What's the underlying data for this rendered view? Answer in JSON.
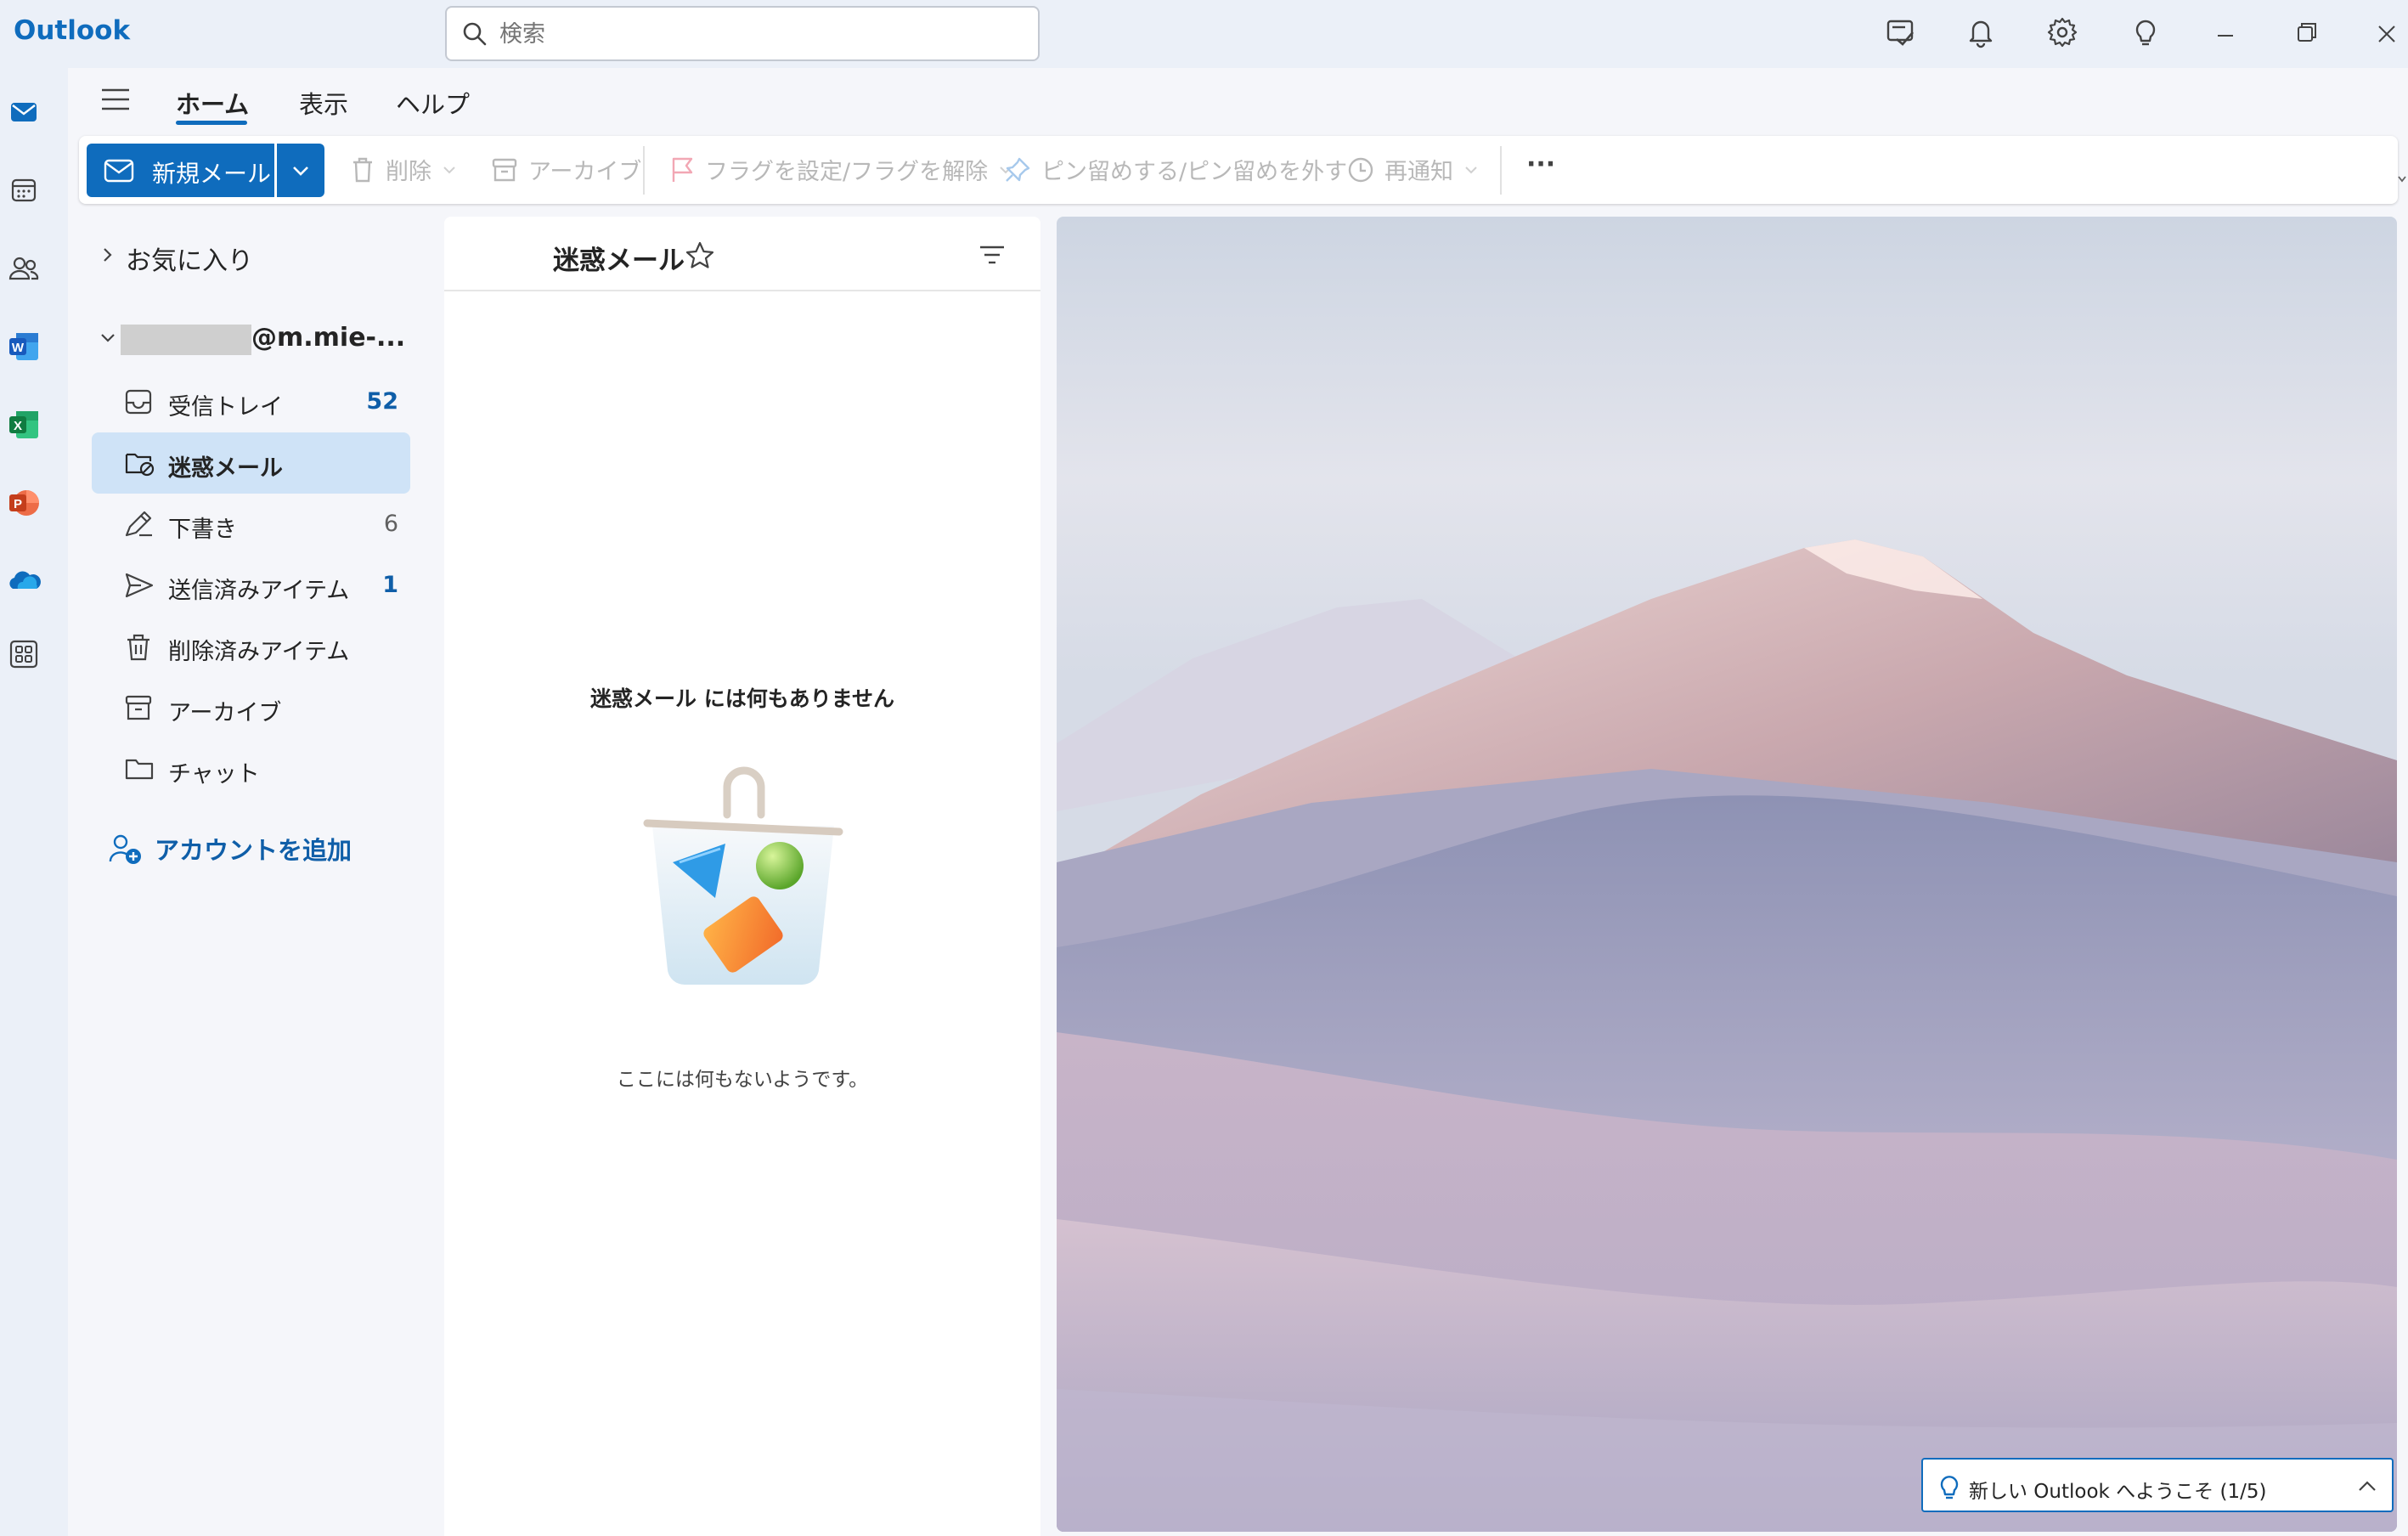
{
  "app": {
    "title": "Outlook"
  },
  "search": {
    "placeholder": "検索"
  },
  "window_controls": [
    "compose-note-icon",
    "bell-icon",
    "gear-icon",
    "lightbulb-icon",
    "minimize-icon",
    "restore-icon",
    "close-icon"
  ],
  "rail": {
    "items": [
      "mail-icon",
      "calendar-icon",
      "people-icon",
      "word-icon",
      "excel-icon",
      "powerpoint-icon",
      "onedrive-icon",
      "apps-icon"
    ]
  },
  "tabs": {
    "home": "ホーム",
    "view": "表示",
    "help": "ヘルプ"
  },
  "ribbon": {
    "new_mail": "新規メール",
    "delete": "削除",
    "archive": "アーカイブ",
    "flag": "フラグを設定/フラグを解除",
    "pin": "ピン留めする/ピン留めを外す",
    "snooze": "再通知",
    "more": "···"
  },
  "folders": {
    "favorites": "お気に入り",
    "account": "@m.mie-...",
    "items": [
      {
        "label": "受信トレイ",
        "count": "52",
        "icon": "inbox-icon"
      },
      {
        "label": "迷惑メール",
        "count": "",
        "icon": "junk-icon",
        "selected": true
      },
      {
        "label": "下書き",
        "count": "6",
        "icon": "draft-icon"
      },
      {
        "label": "送信済みアイテム",
        "count": "1",
        "icon": "sent-icon"
      },
      {
        "label": "削除済みアイテム",
        "count": "",
        "icon": "trash-icon"
      },
      {
        "label": "アーカイブ",
        "count": "",
        "icon": "archive-icon"
      },
      {
        "label": "チャット",
        "count": "",
        "icon": "folder-icon"
      }
    ],
    "add_account": "アカウントを追加"
  },
  "message_list": {
    "title": "迷惑メール",
    "empty_title": "迷惑メール には何もありません",
    "empty_subtitle": "ここには何もないようです。"
  },
  "welcome": {
    "label": "新しい Outlook へようこそ (1/5)"
  },
  "colors": {
    "accent": "#0f6cbd",
    "selected": "#cfe3f7",
    "background": "#f0f3f9"
  }
}
